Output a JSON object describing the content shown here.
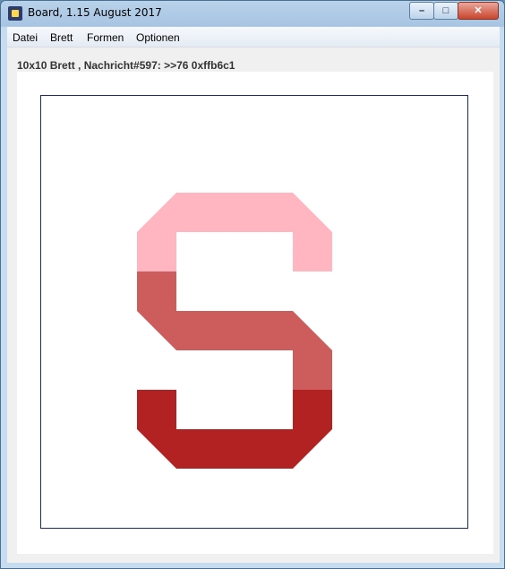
{
  "window": {
    "title": "Board, 1.15 August 2017",
    "controls": {
      "minimize": "–",
      "maximize": "□",
      "close": "✕"
    }
  },
  "menu": {
    "items": [
      "Datei",
      "Brett",
      "Formen",
      "Optionen"
    ]
  },
  "status": {
    "text": "10x10 Brett , Nachricht#597: >>76 0xffb6c1"
  },
  "board": {
    "letter": "S",
    "colors": {
      "top": "#ffb6c1",
      "middle": "#cd5c5c",
      "bottom": "#b22222",
      "frame": "#1a2b5e"
    }
  }
}
